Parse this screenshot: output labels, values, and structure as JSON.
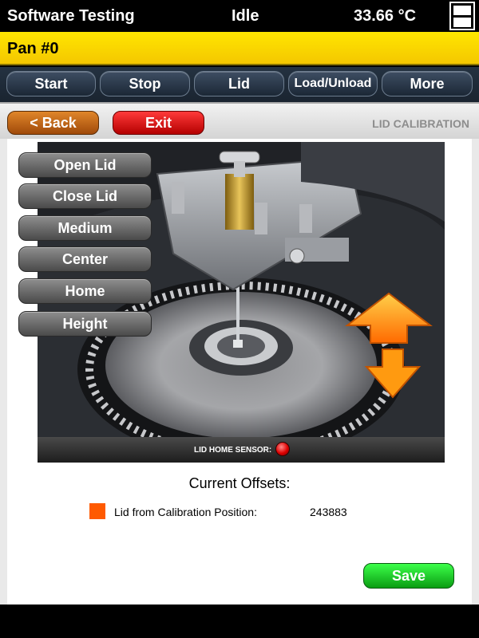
{
  "topbar": {
    "title": "Software Testing",
    "status": "Idle",
    "temperature": "33.66 °C"
  },
  "panbar": {
    "label": "Pan #0"
  },
  "nav": {
    "items": [
      {
        "label": "Start"
      },
      {
        "label": "Stop"
      },
      {
        "label": "Lid"
      },
      {
        "label": "Load/Unload"
      },
      {
        "label": "More"
      }
    ]
  },
  "header": {
    "back_label": "< Back",
    "exit_label": "Exit",
    "screen_title": "LID CALIBRATION"
  },
  "side_buttons": [
    {
      "label": "Open Lid"
    },
    {
      "label": "Close Lid"
    },
    {
      "label": "Medium"
    },
    {
      "label": "Center"
    },
    {
      "label": "Home"
    },
    {
      "label": "Height"
    }
  ],
  "sensor": {
    "label": "LID HOME SENSOR:",
    "state_color": "#d00000"
  },
  "offsets": {
    "title": "Current Offsets:",
    "items": [
      {
        "label": "Lid from Calibration Position:",
        "value": "243883",
        "color": "#ff5a00"
      }
    ]
  },
  "save_label": "Save",
  "colors": {
    "accent_yellow": "#f4c700",
    "back_orange": "#c0621a",
    "exit_red": "#e00000",
    "save_green": "#16c21e",
    "arrow_orange": "#ff8a00"
  }
}
